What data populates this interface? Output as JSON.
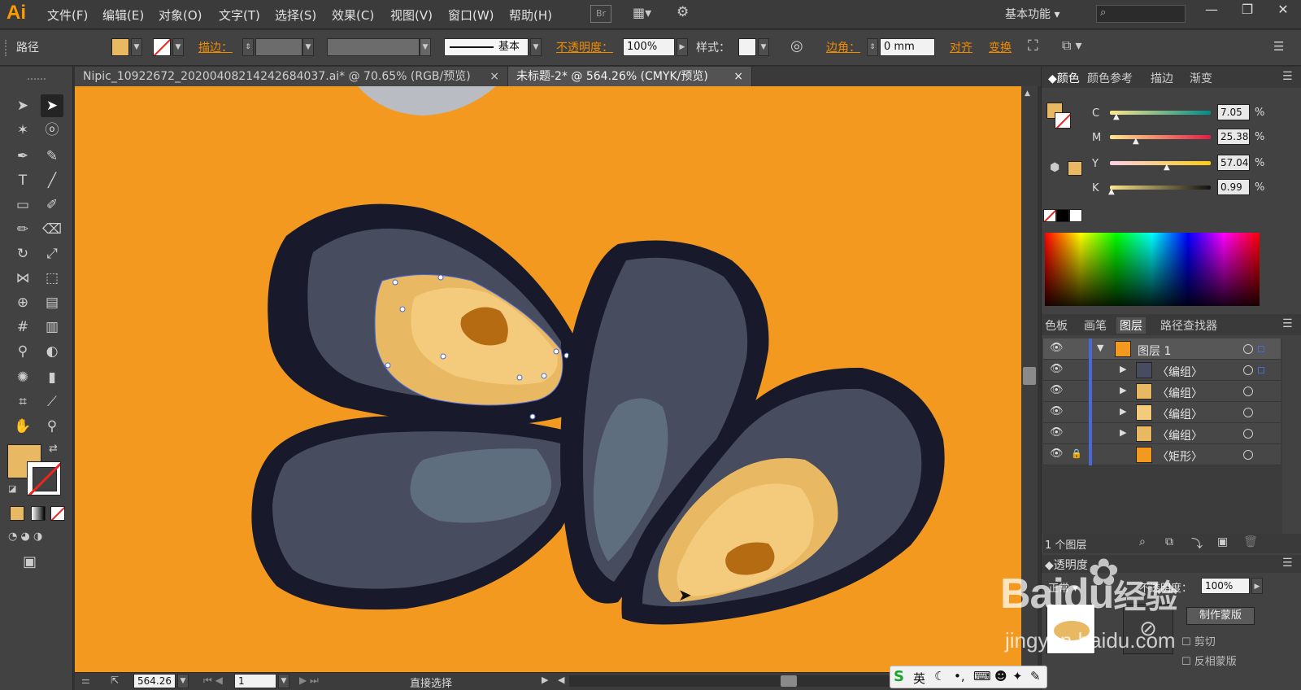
{
  "app": {
    "logo": "Ai",
    "bridge": "Br",
    "workspace": "基本功能"
  },
  "menus": [
    "文件(F)",
    "编辑(E)",
    "对象(O)",
    "文字(T)",
    "选择(S)",
    "效果(C)",
    "视图(V)",
    "窗口(W)",
    "帮助(H)"
  ],
  "window_buttons": [
    "—",
    "❐",
    "✕"
  ],
  "control_bar": {
    "object_label": "路径",
    "stroke_label": "描边：",
    "stroke_style": "基本",
    "opacity_label": "不透明度：",
    "opacity_value": "100%",
    "style_label": "样式：",
    "corner_label": "边角：",
    "corner_value": "0 mm",
    "align_label": "对齐",
    "transform_label": "变换"
  },
  "tabs": [
    {
      "label": "Nipic_10922672_20200408214242684037.ai* @ 70.65% (RGB/预览)",
      "close": "×",
      "active": false
    },
    {
      "label": "未标题-2* @ 564.26% (CMYK/预览)",
      "close": "×",
      "active": true
    }
  ],
  "colors": {
    "canvas": "#f39920",
    "fill": "#e8b862",
    "shell_dark": "#181a2b",
    "shell_mid": "#474c5e",
    "shell_light": "#5f6e7f",
    "meat_light": "#f4ca7c",
    "meat_dark": "#b46b12",
    "selection": "#4a68d8"
  },
  "color_panel": {
    "tabs": [
      "颜色",
      "颜色参考",
      "描边",
      "渐变"
    ],
    "sliders": [
      {
        "label": "C",
        "value": "7.05",
        "pct": "%"
      },
      {
        "label": "M",
        "value": "25.38",
        "pct": "%"
      },
      {
        "label": "Y",
        "value": "57.04",
        "pct": "%"
      },
      {
        "label": "K",
        "value": "0.99",
        "pct": "%"
      }
    ]
  },
  "layers_panel": {
    "tabs": [
      "色板",
      "画笔",
      "图层",
      "路径查找器"
    ],
    "rows": [
      "图层 1",
      "〈编组〉",
      "〈编组〉",
      "〈编组〉",
      "〈编组〉",
      "〈矩形〉"
    ],
    "footer": "1 个图层"
  },
  "transparency_panel": {
    "title": "透明度",
    "mode": "正常",
    "opacity_label": "不透明度：",
    "opacity_value": "100%",
    "mask_button": "制作蒙版",
    "clip_label": "剪切",
    "invert_label": "反相蒙版"
  },
  "status": {
    "zoom": "564.26",
    "artboard": "1",
    "tool": "直接选择"
  },
  "ime": {
    "lang": "英"
  },
  "watermark": {
    "brand": "Baidu",
    "cn": "经验",
    "url": "jingyan.baidu.com"
  }
}
